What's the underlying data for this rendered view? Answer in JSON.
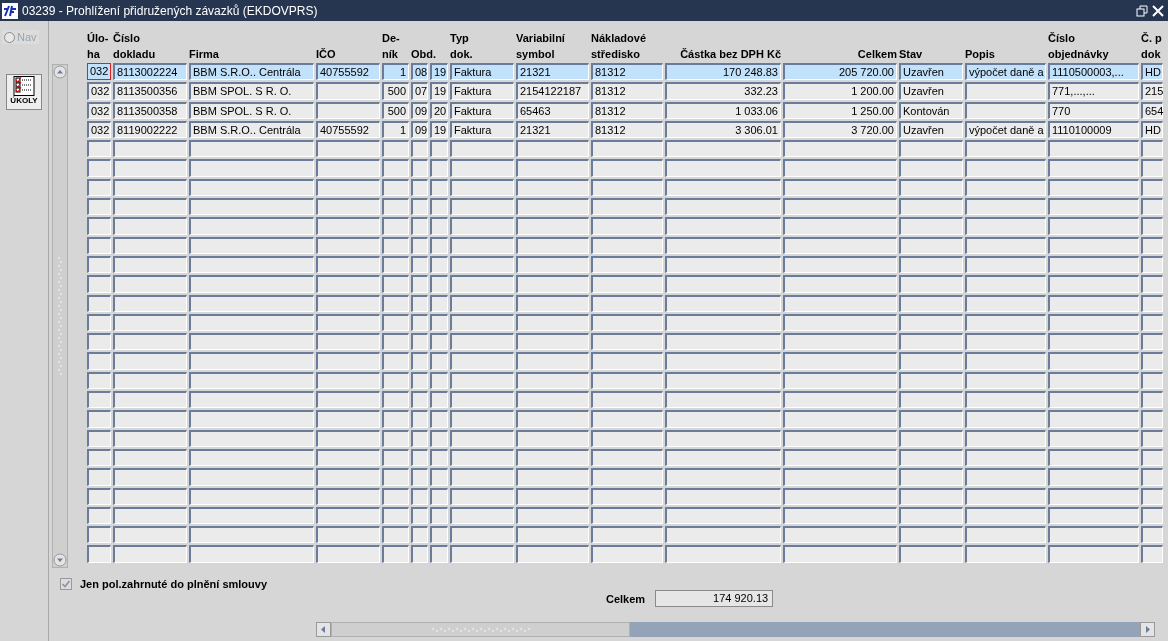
{
  "window": {
    "title": "03239 - Prohlížení přidružených závazků (EKDOVPRS)"
  },
  "sidebar": {
    "nav": {
      "label": "Nav",
      "selected": false,
      "disabled": true
    },
    "tasks_button": {
      "label": "ÚKOLY"
    }
  },
  "table": {
    "columns": [
      {
        "lines": [
          "Úlo-",
          "ha"
        ]
      },
      {
        "lines": [
          "Číslo",
          "dokladu"
        ]
      },
      {
        "lines": [
          "Firma"
        ]
      },
      {
        "lines": [
          "IČO"
        ]
      },
      {
        "lines": [
          "De-",
          "ník"
        ]
      },
      {
        "lines": [
          "Obd."
        ]
      },
      {
        "lines": [
          "Typ",
          "dok."
        ]
      },
      {
        "lines": [
          "Variabilní",
          "symbol"
        ]
      },
      {
        "lines": [
          "Nákladové",
          "středisko"
        ]
      },
      {
        "lines": [
          "Částka bez DPH Kč"
        ]
      },
      {
        "lines": [
          "Celkem"
        ]
      },
      {
        "lines": [
          "Stav"
        ]
      },
      {
        "lines": [
          "Popis"
        ]
      },
      {
        "lines": [
          "Číslo",
          "objednávky"
        ]
      },
      {
        "lines": [
          "Č. p",
          "dok"
        ]
      }
    ],
    "rows": [
      {
        "selected": true,
        "focused": true,
        "cells": [
          "032",
          "8113002224",
          "BBM S.R.O.. Centrála",
          "40755592",
          "1",
          [
            "08",
            "19"
          ],
          "Faktura",
          "21321",
          "81312",
          "170 248.83",
          "205 720.00",
          "Uzavřen",
          "výpočet daně a",
          "1110500003,...",
          "HD"
        ]
      },
      {
        "selected": false,
        "focused": false,
        "cells": [
          "032",
          "8113500356",
          "BBM SPOL. S R. O.",
          "",
          "500",
          [
            "07",
            "19"
          ],
          "Faktura",
          "2154122187",
          "81312",
          "332.23",
          "1 200.00",
          "Uzavřen",
          "",
          "771,...,...",
          "215"
        ]
      },
      {
        "selected": false,
        "focused": false,
        "cells": [
          "032",
          "8113500358",
          "BBM SPOL. S R. O.",
          "",
          "500",
          [
            "09",
            "20"
          ],
          "Faktura",
          "65463",
          "81312",
          "1 033.06",
          "1 250.00",
          "Kontován",
          "",
          "770",
          "654"
        ]
      },
      {
        "selected": false,
        "focused": false,
        "cells": [
          "032",
          "8119002222",
          "BBM S.R.O.. Centrála",
          "40755592",
          "1",
          [
            "09",
            "19"
          ],
          "Faktura",
          "21321",
          "81312",
          "3 306.01",
          "3 720.00",
          "Uzavřen",
          "výpočet daně a",
          "1110100009",
          "HD"
        ]
      }
    ]
  },
  "filter": {
    "label": "Jen pol.zahrnuté do plnění smlouvy",
    "checked": true,
    "disabled": true
  },
  "total": {
    "label": "Celkem",
    "value": "174 920.13"
  }
}
